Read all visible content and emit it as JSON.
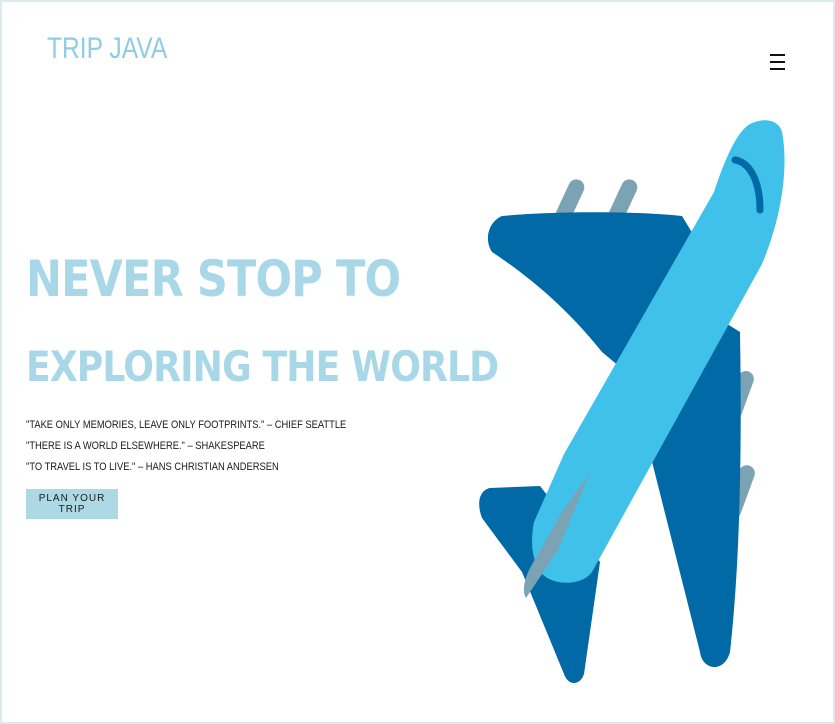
{
  "header": {
    "logo_text": "TRIP JAVA",
    "menu_icon": "hamburger-menu-icon"
  },
  "hero": {
    "line1": "NEVER STOP TO",
    "line2": "EXPLORING THE WORLD",
    "quotes": [
      "\"TAKE ONLY MEMORIES, LEAVE ONLY FOOTPRINTS.\" – CHIEF SEATTLE",
      "\"THERE IS A WORLD ELSEWHERE.\" – SHAKESPEARE",
      "\"TO TRAVEL IS TO LIVE.\" – HANS CHRISTIAN ANDERSEN"
    ],
    "cta_label": "PLAN YOUR TRIP"
  },
  "illustration": {
    "icon": "airplane-icon"
  },
  "colors": {
    "accent": "#add8e6",
    "logo": "#8ecde3",
    "hero_text": "#a8d8e8",
    "plane_light": "#40c1ea",
    "plane_dark": "#0069a6",
    "plane_engine": "#7ba3b3"
  }
}
